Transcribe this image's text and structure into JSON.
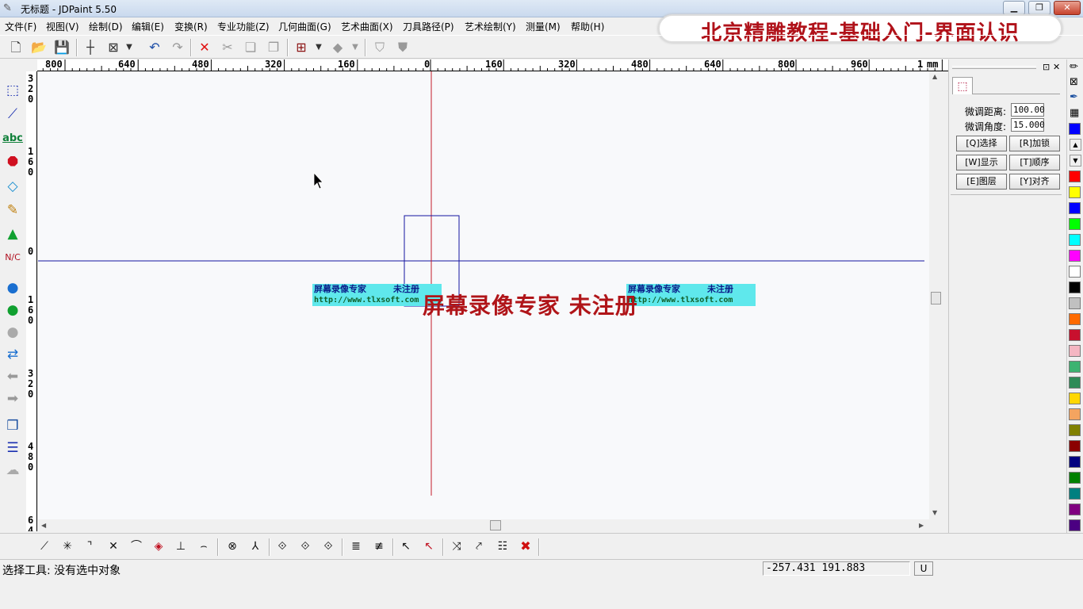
{
  "window": {
    "title": "无标题 - JDPaint 5.50",
    "banner": "北京精雕教程-基础入门-界面认识",
    "min_glyph": "▁",
    "max_glyph": "❐",
    "close_glyph": "✕"
  },
  "menu": [
    "文件(F)",
    "视图(V)",
    "绘制(D)",
    "编辑(E)",
    "变换(R)",
    "专业功能(Z)",
    "几何曲面(G)",
    "艺术曲面(X)",
    "刀具路径(P)",
    "艺术绘制(Y)",
    "测量(M)",
    "帮助(H)"
  ],
  "ruler": {
    "top_labels": [
      "800",
      "640",
      "480",
      "320",
      "160",
      "0",
      "160",
      "320",
      "480",
      "640",
      "800",
      "960"
    ],
    "top_unit": "mm",
    "top_last": "1",
    "left_groups": [
      [
        "3",
        "2",
        "0"
      ],
      [
        "1",
        "6",
        "0"
      ],
      [
        "0"
      ],
      [
        "1",
        "6",
        "0"
      ],
      [
        "3",
        "2",
        "0"
      ],
      [
        "4",
        "8",
        "0"
      ],
      [
        "6",
        "4"
      ]
    ]
  },
  "right_panel": {
    "pin_glyph": "⊡",
    "close_glyph": "✕",
    "fine_distance_label": "微调距离:",
    "fine_distance_value": "100.00",
    "fine_angle_label": "微调角度:",
    "fine_angle_value": "15.000",
    "buttons": [
      "[Q]选择",
      "[R]加锁",
      "[W]显示",
      "[T]顺序",
      "[E]图层",
      "[Y]对齐"
    ]
  },
  "palette": {
    "scroll_up": "▲",
    "scroll_down": "▼",
    "colors": [
      "#ff0000",
      "#ffff00",
      "#0000ff",
      "#00ff00",
      "#00ffff",
      "#ff00ff",
      "#ffffff",
      "#000000",
      "#c0c0c0",
      "#ff6a00",
      "#c8102e",
      "#f4b6c2",
      "#3cb371",
      "#2e8b57",
      "#ffd700",
      "#f4a460",
      "#808000",
      "#8b0000",
      "#000080",
      "#008000",
      "#008080",
      "#800080",
      "#4b0082"
    ]
  },
  "watermark": {
    "brand": "屏幕录像专家",
    "unregistered": "未注册",
    "url": "http://www.tlxsoft.com",
    "big": "屏幕录像专家  未注册"
  },
  "status": {
    "message": "选择工具: 没有选中对象",
    "coords": "-257.431  191.883",
    "unit_button": "U"
  }
}
